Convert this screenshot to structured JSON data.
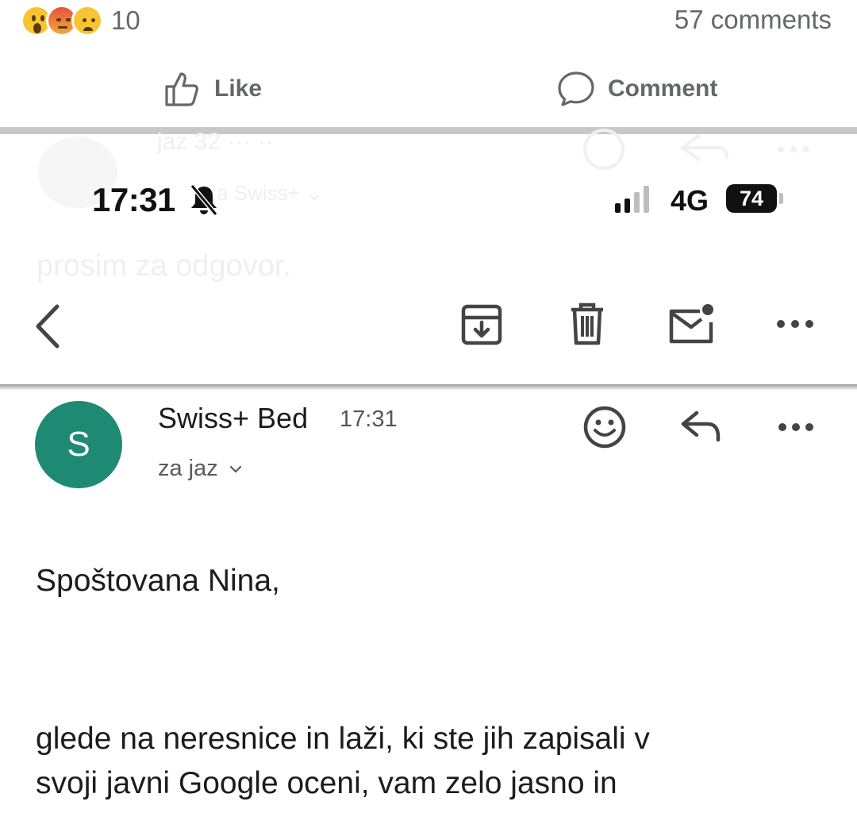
{
  "post": {
    "reaction_icons": [
      "wow-emoji-icon",
      "angry-emoji-icon",
      "sad-emoji-icon"
    ],
    "reaction_count": "10",
    "comments_count": "57 comments",
    "like_label": "Like",
    "comment_label": "Comment"
  },
  "background_text": {
    "line1": "jaz   32 ··· ··",
    "line2": "za Swiss+  ⌄",
    "line3": "prosim za odgovor."
  },
  "status_bar": {
    "time": "17:31",
    "network": "4G",
    "battery": "74",
    "icons": [
      "bell-slash-icon",
      "signal-icon",
      "battery-icon"
    ]
  },
  "toolbar": {
    "icons": [
      "back-icon",
      "archive-icon",
      "trash-icon",
      "mark-unread-icon",
      "more-icon"
    ]
  },
  "message": {
    "avatar_letter": "S",
    "sender": "Swiss+ Bed",
    "time": "17:31",
    "recipient": "za jaz",
    "greeting": "Spoštovana Nina,",
    "lines": [
      "glede na neresnice in laži, ki ste jih zapisali v",
      "svoji javni Google oceni, vam zelo jasno in"
    ]
  },
  "colors": {
    "avatar": "#1f8a74",
    "fb_gray": "#65676b",
    "divider": "#c8c8cc"
  }
}
